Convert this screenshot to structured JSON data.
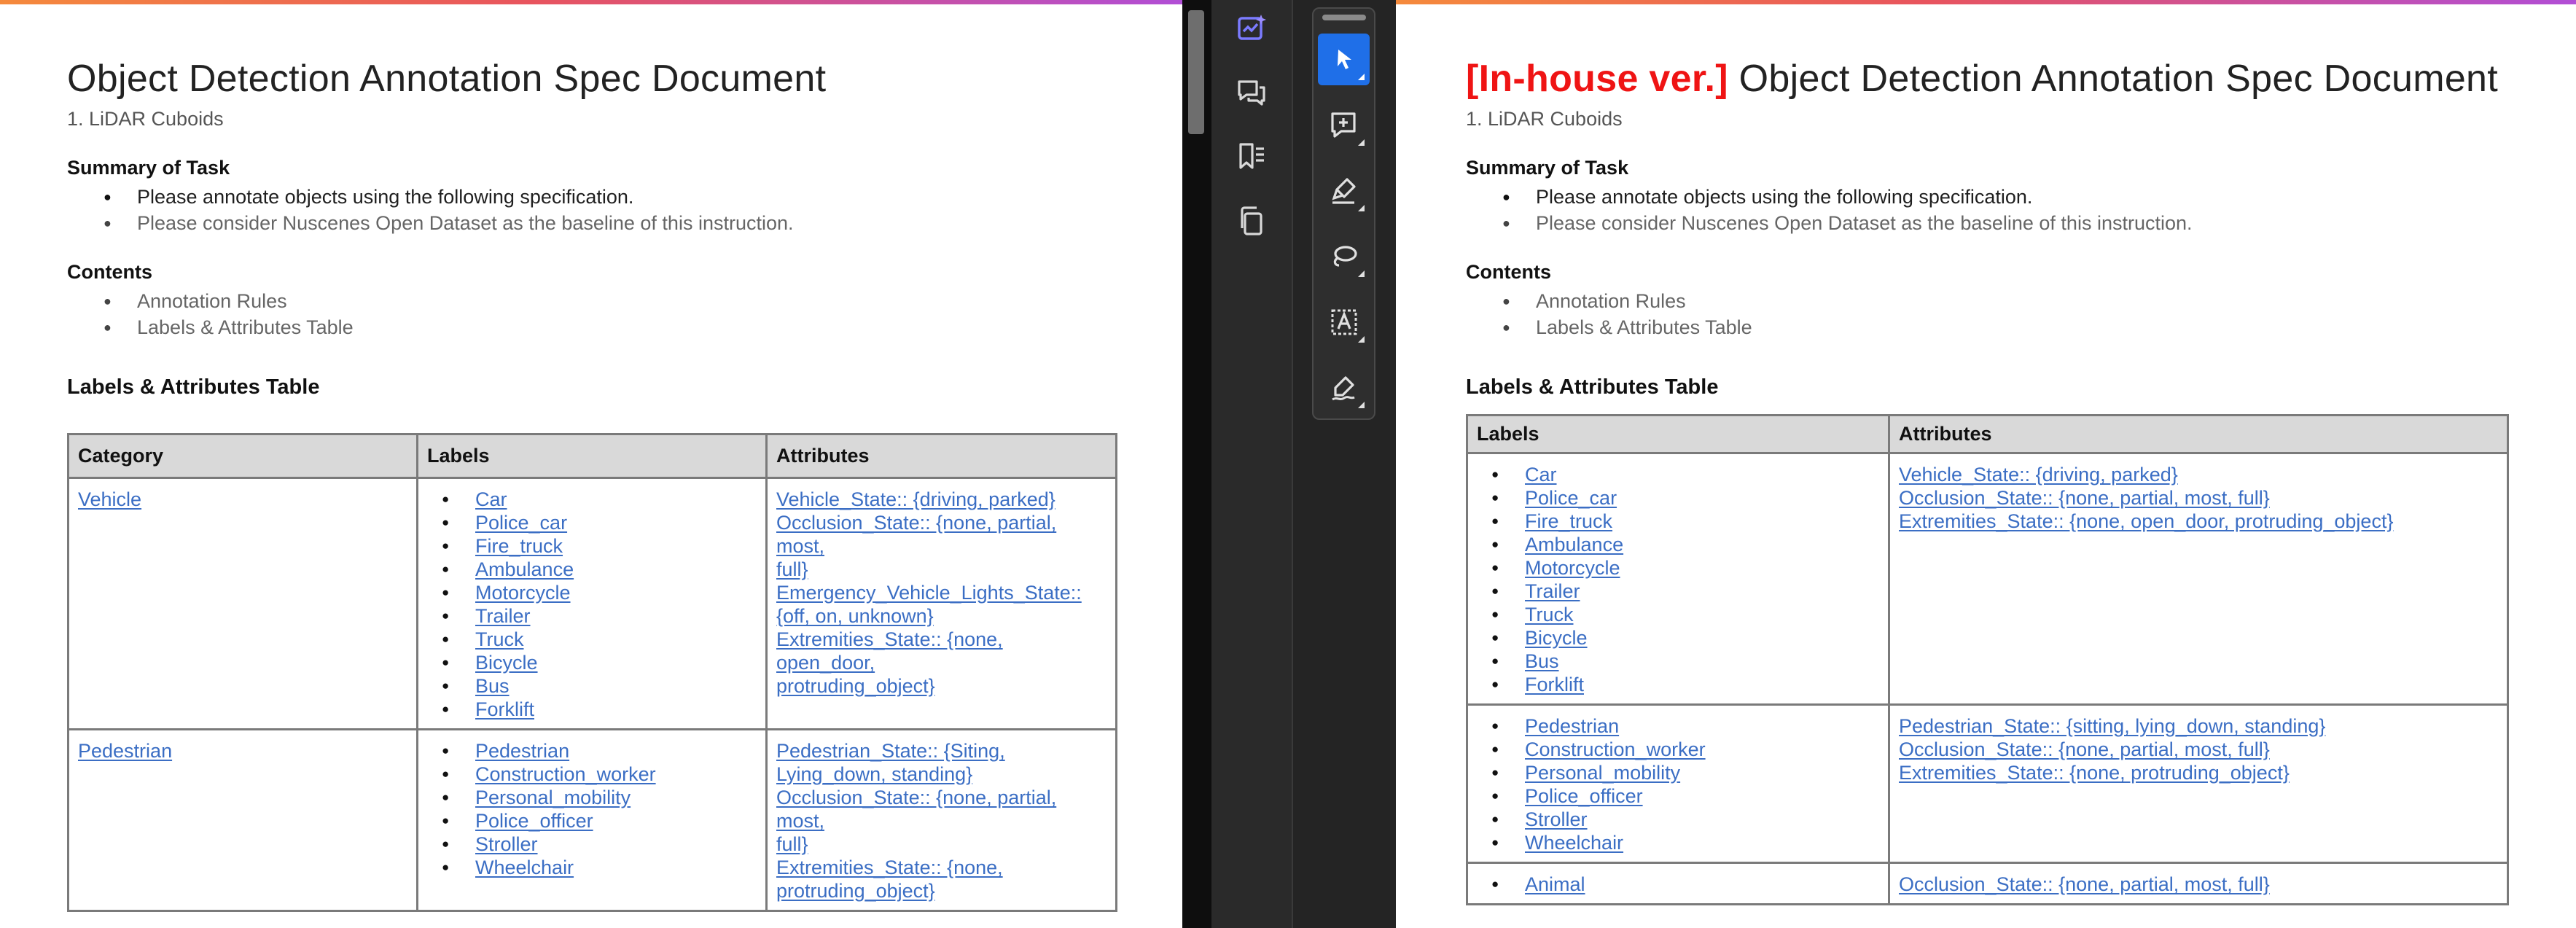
{
  "left_doc": {
    "title": "Object Detection Annotation Spec Document",
    "subtitle": "1. LiDAR Cuboids",
    "summary_heading": "Summary of Task",
    "summary_items": [
      "Please annotate objects using the following specification.",
      "Please consider Nuscenes Open Dataset as the baseline of this instruction."
    ],
    "contents_heading": "Contents",
    "contents_items": [
      "Annotation Rules",
      "Labels & Attributes Table"
    ],
    "table_heading": "Labels & Attributes Table",
    "table": {
      "headers": [
        "Category",
        "Labels",
        "Attributes"
      ],
      "rows": [
        {
          "category": "Vehicle",
          "labels": [
            "Car",
            "Police_car",
            "Fire_truck",
            "Ambulance",
            "Motorcycle",
            "Trailer",
            "Truck",
            "Bicycle",
            "Bus",
            "Forklift"
          ],
          "attributes_lines": [
            "Vehicle_State:: {driving, parked}",
            "Occlusion_State:: {none, partial, most,",
            "full}",
            "Emergency_Vehicle_Lights_State::",
            "{off, on, unknown}",
            "Extremities_State:: {none, open_door,",
            "protruding_object}"
          ]
        },
        {
          "category": "Pedestrian",
          "labels": [
            "Pedestrian",
            "Construction_worker",
            "Personal_mobility",
            "Police_officer",
            "Stroller",
            "Wheelchair"
          ],
          "attributes_lines": [
            "Pedestrian_State:: {Siting,",
            "Lying_down, standing}",
            "Occlusion_State:: {none, partial, most,",
            "full}",
            "Extremities_State:: {none,",
            "protruding_object}"
          ]
        }
      ]
    }
  },
  "right_doc": {
    "title_prefix": "[In-house ver.]",
    "title": "Object Detection Annotation Spec Document",
    "subtitle": "1. LiDAR Cuboids",
    "summary_heading": "Summary of Task",
    "summary_items": [
      "Please annotate objects using the following specification.",
      "Please consider Nuscenes Open Dataset as the baseline of this instruction."
    ],
    "contents_heading": "Contents",
    "contents_items": [
      "Annotation Rules",
      "Labels & Attributes Table"
    ],
    "table_heading": "Labels & Attributes Table",
    "table": {
      "headers": [
        "Labels",
        "Attributes"
      ],
      "rows": [
        {
          "labels": [
            "Car",
            "Police_car",
            "Fire_truck",
            "Ambulance",
            "Motorcycle",
            "Trailer",
            "Truck",
            "Bicycle",
            "Bus",
            "Forklift"
          ],
          "attributes_lines": [
            "Vehicle_State:: {driving, parked}",
            "Occlusion_State:: {none, partial, most, full}",
            "Extremities_State:: {none, open_door, protruding_object}"
          ]
        },
        {
          "labels": [
            "Pedestrian",
            "Construction_worker",
            "Personal_mobility",
            "Police_officer",
            "Stroller",
            "Wheelchair"
          ],
          "attributes_lines": [
            "Pedestrian_State:: {sitting, lying_down, standing}",
            "Occlusion_State:: {none, partial, most, full}",
            "Extremities_State:: {none, protruding_object}"
          ]
        },
        {
          "labels": [
            "Animal"
          ],
          "attributes_lines": [
            "Occlusion_State:: {none, partial, most, full}"
          ]
        }
      ]
    }
  },
  "sidebar": {
    "icons": [
      "ai-assistant-icon",
      "comments-icon",
      "bookmarks-icon",
      "pages-icon"
    ]
  },
  "toolbar": {
    "tools": [
      "select-tool-icon",
      "add-comment-icon",
      "highlight-icon",
      "lasso-icon",
      "text-box-icon",
      "sign-icon"
    ],
    "active": "select-tool-icon"
  },
  "colors": {
    "link": "#3b6ec4",
    "prefix_red": "#ef1414",
    "active_tool": "#1f6fe8",
    "accent_gradient": [
      "#f58a3c",
      "#e8545e",
      "#b14ed6"
    ]
  }
}
